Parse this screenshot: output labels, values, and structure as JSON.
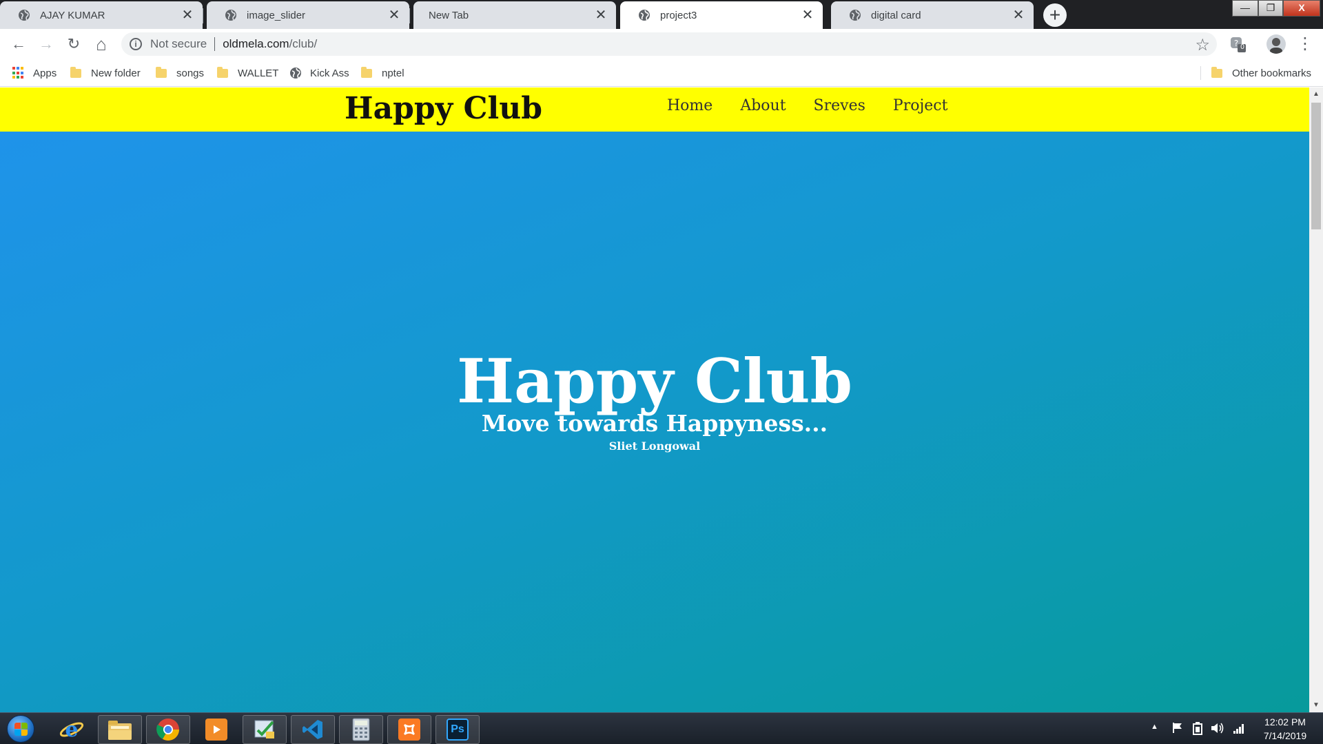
{
  "browser": {
    "tabs": [
      {
        "title": "AJAY KUMAR",
        "active": false
      },
      {
        "title": "image_slider",
        "active": false
      },
      {
        "title": "New Tab",
        "active": false
      },
      {
        "title": "project3",
        "active": true
      },
      {
        "title": "digital card",
        "active": false
      }
    ],
    "tab_close_glyph": "✕",
    "new_tab_glyph": "+",
    "window_controls": {
      "minimize": "—",
      "maximize": "❐",
      "close": "X"
    },
    "toolbar": {
      "back_glyph": "←",
      "forward_glyph": "→",
      "reload_glyph": "↻",
      "home_glyph": "⌂",
      "info_glyph": "i",
      "security_text": "Not secure",
      "url_host": "oldmela.com",
      "url_path": "/club/",
      "star_glyph": "☆",
      "extension_badge": "0",
      "menu_glyph": "⋮"
    },
    "bookmarks": [
      {
        "label": "Apps",
        "icon": "apps-grid-icon"
      },
      {
        "label": "New folder",
        "icon": "folder-icon"
      },
      {
        "label": "songs",
        "icon": "folder-icon"
      },
      {
        "label": "WALLET",
        "icon": "folder-icon"
      },
      {
        "label": "Kick Ass",
        "icon": "globe-icon"
      },
      {
        "label": "nptel",
        "icon": "folder-icon"
      }
    ],
    "other_bookmarks": "Other bookmarks"
  },
  "site": {
    "logo": "Happy Club",
    "nav": [
      "Home",
      "About",
      "Sreves",
      "Project"
    ],
    "hero_title": "Happy Club",
    "hero_subtitle": "Move towards Happyness...",
    "hero_caption": "Sliet Longowal",
    "colors": {
      "nav_bg": "#ffff00",
      "hero_start": "#1f93ea",
      "hero_end": "#079a9b"
    }
  },
  "taskbar": {
    "apps": [
      "internet-explorer-icon",
      "file-explorer-icon",
      "chrome-icon",
      "media-player-icon",
      "task-app-icon",
      "vscode-icon",
      "calculator-icon",
      "xampp-icon",
      "photoshop-icon"
    ],
    "photoshop_label": "Ps",
    "clock_time": "12:02 PM",
    "clock_date": "7/14/2019"
  }
}
